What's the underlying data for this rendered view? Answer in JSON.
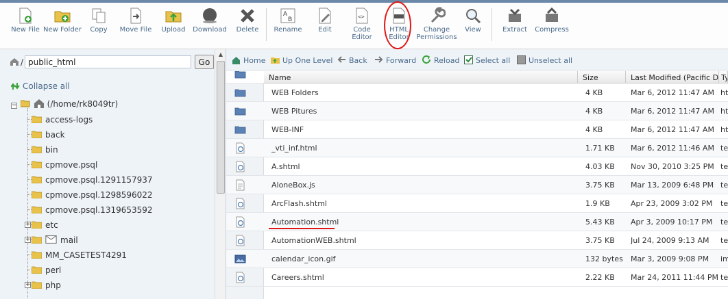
{
  "toolbar": {
    "buttons": [
      {
        "id": "new-file",
        "label": "New File"
      },
      {
        "id": "new-folder",
        "label": "New Folder"
      },
      {
        "id": "copy",
        "label": "Copy"
      },
      {
        "id": "move-file",
        "label": "Move File"
      },
      {
        "id": "upload",
        "label": "Upload"
      },
      {
        "id": "download",
        "label": "Download"
      },
      {
        "id": "delete",
        "label": "Delete"
      },
      {
        "id": "rename",
        "label": "Rename"
      },
      {
        "id": "edit",
        "label": "Edit"
      },
      {
        "id": "code-editor",
        "label": "Code Editor"
      },
      {
        "id": "html-editor",
        "label": "HTML Editor"
      },
      {
        "id": "change-permissions",
        "label": "Change Permissions"
      },
      {
        "id": "view",
        "label": "View"
      },
      {
        "id": "extract",
        "label": "Extract"
      },
      {
        "id": "compress",
        "label": "Compress"
      }
    ]
  },
  "left": {
    "path_value": "public_html",
    "go_label": "Go",
    "collapse_label": "Collapse all",
    "root_label": "(/home/rk8049tr)",
    "items": [
      {
        "label": "access-logs",
        "expandable": false
      },
      {
        "label": "back",
        "expandable": false
      },
      {
        "label": "bin",
        "expandable": false
      },
      {
        "label": "cpmove.psql",
        "expandable": false
      },
      {
        "label": "cpmove.psql.1291157937",
        "expandable": false
      },
      {
        "label": "cpmove.psql.1298596022",
        "expandable": false
      },
      {
        "label": "cpmove.psql.1319653592",
        "expandable": false
      },
      {
        "label": "etc",
        "expandable": true
      },
      {
        "label": "mail",
        "expandable": true
      },
      {
        "label": "MM_CASETEST4291",
        "expandable": false
      },
      {
        "label": "perl",
        "expandable": false
      },
      {
        "label": "php",
        "expandable": true
      }
    ]
  },
  "nav": {
    "home": "Home",
    "up": "Up One Level",
    "back": "Back",
    "forward": "Forward",
    "reload": "Reload",
    "select_all": "Select all",
    "unselect_all": "Unselect all"
  },
  "grid": {
    "headers": {
      "name": "Name",
      "size": "Size",
      "modified": "Last Modified (Pacific Da",
      "type": "Ty"
    },
    "rows": [
      {
        "name": "WEB Folders",
        "size": "4 KB",
        "modified": "Mar 6, 2012 11:47 AM",
        "type": "htt",
        "kind": "folder"
      },
      {
        "name": "WEB Pitures",
        "size": "4 KB",
        "modified": "Mar 6, 2012 11:47 AM",
        "type": "htt",
        "kind": "folder"
      },
      {
        "name": "WEB-INF",
        "size": "4 KB",
        "modified": "Mar 6, 2012 11:47 AM",
        "type": "htt",
        "kind": "folder"
      },
      {
        "name": "_vti_inf.html",
        "size": "1.71 KB",
        "modified": "Mar 6, 2012 11:46 AM",
        "type": "tex",
        "kind": "web"
      },
      {
        "name": "A.shtml",
        "size": "4.03 KB",
        "modified": "Nov 30, 2010 3:25 PM",
        "type": "tex",
        "kind": "web"
      },
      {
        "name": "AloneBox.js",
        "size": "3.75 KB",
        "modified": "Mar 13, 2009 6:48 PM",
        "type": "tex",
        "kind": "doc"
      },
      {
        "name": "ArcFlash.shtml",
        "size": "1.9 KB",
        "modified": "Apr 23, 2009 3:02 PM",
        "type": "tex",
        "kind": "web"
      },
      {
        "name": "Automation.shtml",
        "size": "5.43 KB",
        "modified": "Apr 3, 2009 10:17 PM",
        "type": "tex",
        "kind": "web"
      },
      {
        "name": "AutomationWEB.shtml",
        "size": "3.75 KB",
        "modified": "Jul 24, 2009 9:13 AM",
        "type": "tex",
        "kind": "web"
      },
      {
        "name": "calendar_icon.gif",
        "size": "132 bytes",
        "modified": "Mar 3, 2009 9:08 PM",
        "type": "im",
        "kind": "image"
      },
      {
        "name": "Careers.shtml",
        "size": "2.22 KB",
        "modified": "Mar 24, 2011 11:44 PM",
        "type": "tex",
        "kind": "web"
      }
    ]
  },
  "colors": {
    "accent": "#4a6a8a",
    "annotation": "#e01515"
  }
}
